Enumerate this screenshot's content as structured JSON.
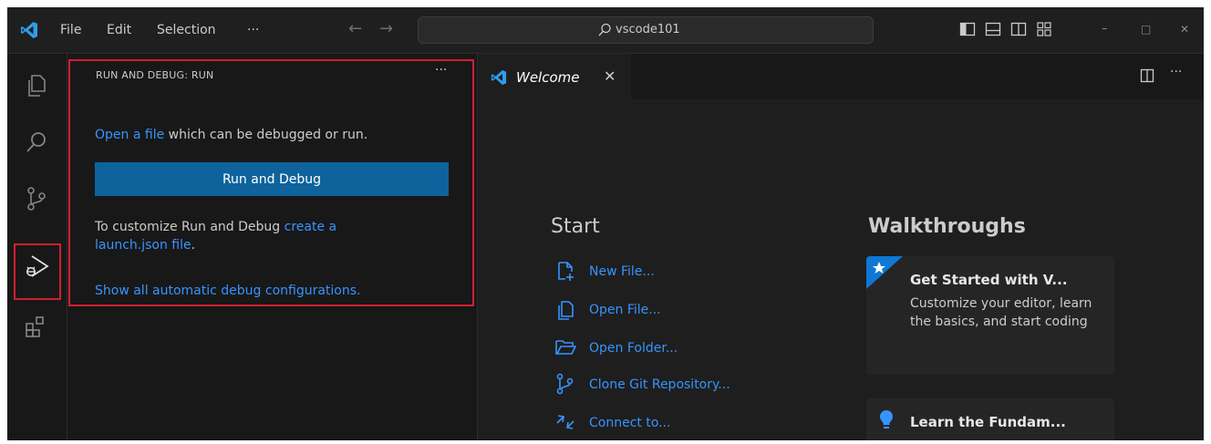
{
  "titlebar": {
    "menu": [
      "File",
      "Edit",
      "Selection",
      "···"
    ],
    "back_arrow": "←",
    "forward_arrow": "→",
    "search_text": "vscode101",
    "minimize": "–",
    "restore": "□",
    "close": "✕"
  },
  "activity_bar": {
    "items": [
      "explorer-icon",
      "search-icon",
      "source-control-icon",
      "run-debug-icon",
      "extensions-icon"
    ],
    "active": "run-debug-icon"
  },
  "sidebar": {
    "title": "RUN AND DEBUG: RUN",
    "more": "···",
    "open_file_link": "Open a file",
    "open_file_rest": " which can be debugged or run.",
    "run_button": "Run and Debug",
    "customize_text": "To customize Run and Debug ",
    "customize_link": "create a launch.json file",
    "customize_end": ".",
    "show_all_link": "Show all automatic debug configurations."
  },
  "editor": {
    "tab_label": "Welcome",
    "tab_close": "✕",
    "more": "···",
    "start": {
      "heading": "Start",
      "items": [
        "New File...",
        "Open File...",
        "Open Folder...",
        "Clone Git Repository...",
        "Connect to..."
      ]
    },
    "walkthroughs": {
      "heading": "Walkthroughs",
      "card1_title": "Get Started with V...",
      "card1_desc": "Customize your editor, learn the basics, and start coding",
      "card2_title": "Learn the Fundam..."
    }
  },
  "colors": {
    "accent": "#0e639c",
    "link": "#3794ff",
    "highlight": "#d0202e",
    "background": "#1e1e1e"
  }
}
